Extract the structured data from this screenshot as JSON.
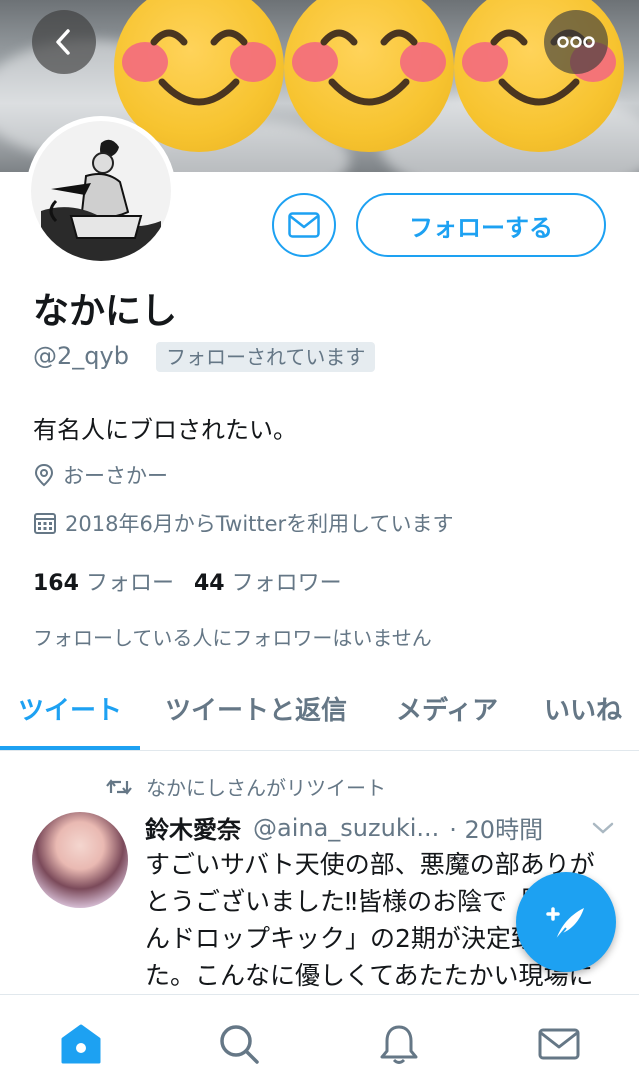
{
  "header": {
    "back_icon": "chevron-left-icon",
    "more_icon": "more-horizontal-icon"
  },
  "profile": {
    "name": "なかにし",
    "handle": "@2_qyb",
    "follows_you_badge": "フォローされています",
    "bio": "有名人にブロされたい。",
    "location": "おーさかー",
    "joined": "2018年6月からTwitterを利用しています",
    "following_count": "164",
    "following_label": "フォロー",
    "followers_count": "44",
    "followers_label": "フォロワー",
    "mutual_note": "フォローしている人にフォロワーはいません",
    "follow_button": "フォローする"
  },
  "tabs": [
    {
      "label": "ツイート",
      "active": true
    },
    {
      "label": "ツイートと返信",
      "active": false
    },
    {
      "label": "メディア",
      "active": false
    },
    {
      "label": "いいね",
      "active": false
    }
  ],
  "tweet": {
    "retweet_context": "なかにしさんがリツイート",
    "author_name": "鈴木愛奈",
    "author_handle": "@aina_suzuki...",
    "time": "· 20時間",
    "text": "すごいサバト天使の部、悪魔の部ありがとうございました‼︎皆様のお陰で「神ちゃんドロップキック」の2期が決定致しました。こんなに優しくてあたたかい現場にいられる幸せを感じました"
  },
  "bottom_nav": [
    "home-icon",
    "search-icon",
    "notifications-icon",
    "messages-icon"
  ],
  "colors": {
    "accent": "#1da1f2",
    "text_primary": "#14171a",
    "text_secondary": "#657786"
  }
}
